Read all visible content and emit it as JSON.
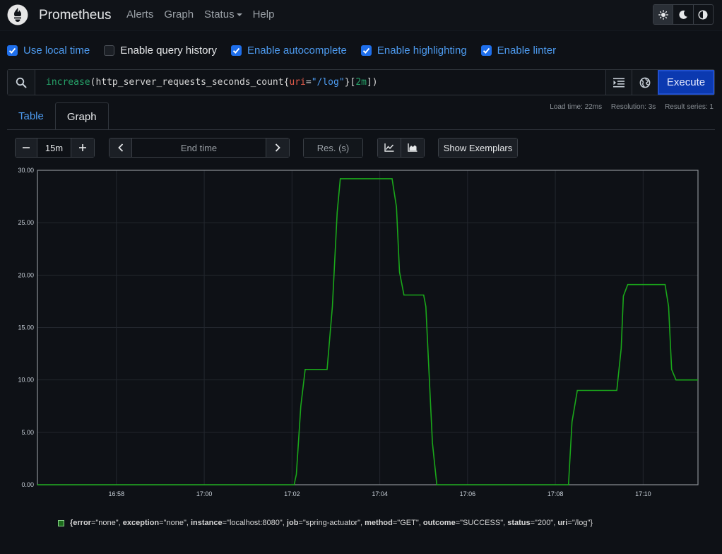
{
  "nav": {
    "brand": "Prometheus",
    "links": [
      "Alerts",
      "Graph",
      "Status",
      "Help"
    ]
  },
  "options": [
    {
      "label": "Use local time",
      "checked": true
    },
    {
      "label": "Enable query history",
      "checked": false
    },
    {
      "label": "Enable autocomplete",
      "checked": true
    },
    {
      "label": "Enable highlighting",
      "checked": true
    },
    {
      "label": "Enable linter",
      "checked": true
    }
  ],
  "query": {
    "fn": "increase",
    "metric": "http_server_requests_seconds_count",
    "label_name": "uri",
    "op": "=",
    "label_value": "\"/log\"",
    "range": "2m",
    "execute_label": "Execute"
  },
  "stats": {
    "load_time": "Load time: 22ms",
    "resolution": "Resolution: 3s",
    "result_series": "Result series: 1"
  },
  "tabs": [
    {
      "label": "Table",
      "active": false
    },
    {
      "label": "Graph",
      "active": true
    }
  ],
  "controls": {
    "range_value": "15m",
    "end_time_placeholder": "End time",
    "resolution_placeholder": "Res. (s)",
    "exemplars_label": "Show Exemplars"
  },
  "legend": {
    "parts": [
      {
        "k": "{error",
        "v": "=\"none\", "
      },
      {
        "k": "exception",
        "v": "=\"none\", "
      },
      {
        "k": "instance",
        "v": "=\"localhost:8080\", "
      },
      {
        "k": "job",
        "v": "=\"spring-actuator\", "
      },
      {
        "k": "method",
        "v": "=\"GET\", "
      },
      {
        "k": "outcome",
        "v": "=\"SUCCESS\", "
      },
      {
        "k": "status",
        "v": "=\"200\", "
      },
      {
        "k": "uri",
        "v": "=\"/log\"}"
      }
    ]
  },
  "colors": {
    "accent": "#1f6feb",
    "series": "#1aa81a",
    "execute": "#0b39b0"
  },
  "chart_data": {
    "type": "line",
    "x_unit": "minutes since 16:57",
    "x_tick_labels": [
      "16:58",
      "17:00",
      "17:02",
      "17:04",
      "17:06",
      "17:08",
      "17:10"
    ],
    "x_ticks": [
      1,
      3,
      5,
      7,
      9,
      11,
      13
    ],
    "xlim": [
      -0.8,
      14.25
    ],
    "ylim": [
      0,
      30
    ],
    "y_tick_labels": [
      "0.00",
      "5.00",
      "10.00",
      "15.00",
      "20.00",
      "25.00",
      "30.00"
    ],
    "y_ticks": [
      0,
      5,
      10,
      15,
      20,
      25,
      30
    ],
    "grid": true,
    "series": [
      {
        "name": "{error=\"none\", exception=\"none\", instance=\"localhost:8080\", job=\"spring-actuator\", method=\"GET\", outcome=\"SUCCESS\", status=\"200\", uri=\"/log\"}",
        "x": [
          -0.8,
          5.05,
          5.1,
          5.2,
          5.3,
          5.5,
          5.8,
          5.92,
          6.03,
          6.1,
          6.2,
          7.28,
          7.38,
          7.45,
          7.55,
          8.0,
          8.05,
          8.2,
          8.3,
          11.3,
          11.38,
          11.5,
          12.3,
          12.4,
          12.5,
          12.55,
          12.65,
          13.5,
          13.58,
          13.65,
          13.75,
          14.25
        ],
        "y": [
          0,
          0,
          1,
          7.5,
          11,
          11,
          11,
          17,
          26,
          29.2,
          29.2,
          29.2,
          26.5,
          20.3,
          18.1,
          18.1,
          17,
          4,
          0,
          0,
          6,
          9,
          9,
          9,
          13,
          18,
          19.1,
          19.1,
          17,
          11,
          10,
          10
        ]
      }
    ]
  }
}
